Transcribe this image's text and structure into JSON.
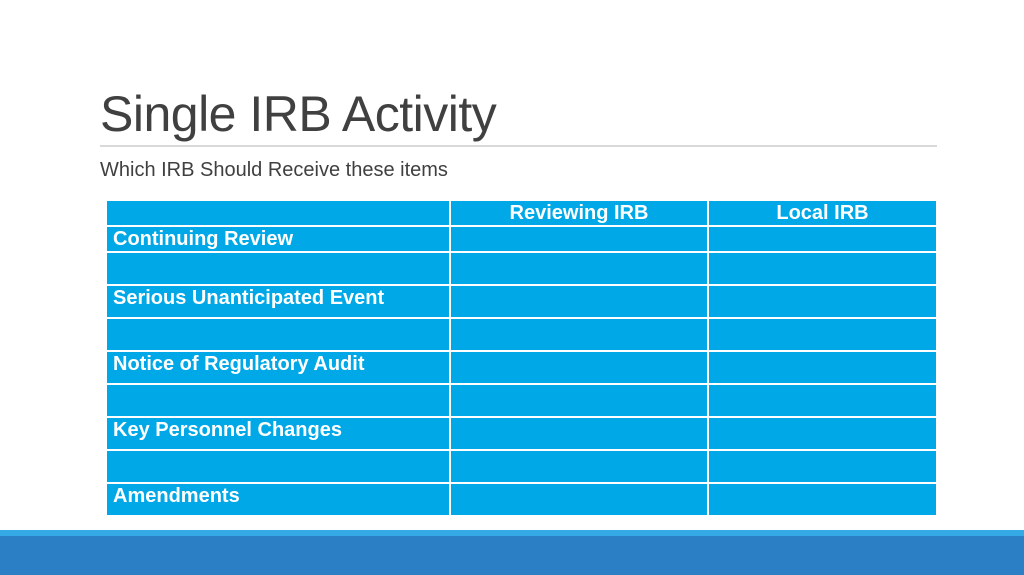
{
  "slide": {
    "title": "Single IRB Activity",
    "subtitle": "Which IRB Should Receive these items"
  },
  "table": {
    "columns": [
      "",
      "Reviewing IRB",
      "Local IRB"
    ],
    "rows": [
      "Continuing Review",
      "",
      "Serious Unanticipated Event",
      "",
      "Notice of Regulatory Audit",
      "",
      "Key Personnel Changes",
      "",
      "Amendments"
    ]
  },
  "colors": {
    "table_fill": "#00a8e8",
    "table_text": "#ffffff",
    "title_text": "#404040",
    "footer_bar": "#2a7fc5",
    "footer_highlight": "#35a8e6"
  }
}
